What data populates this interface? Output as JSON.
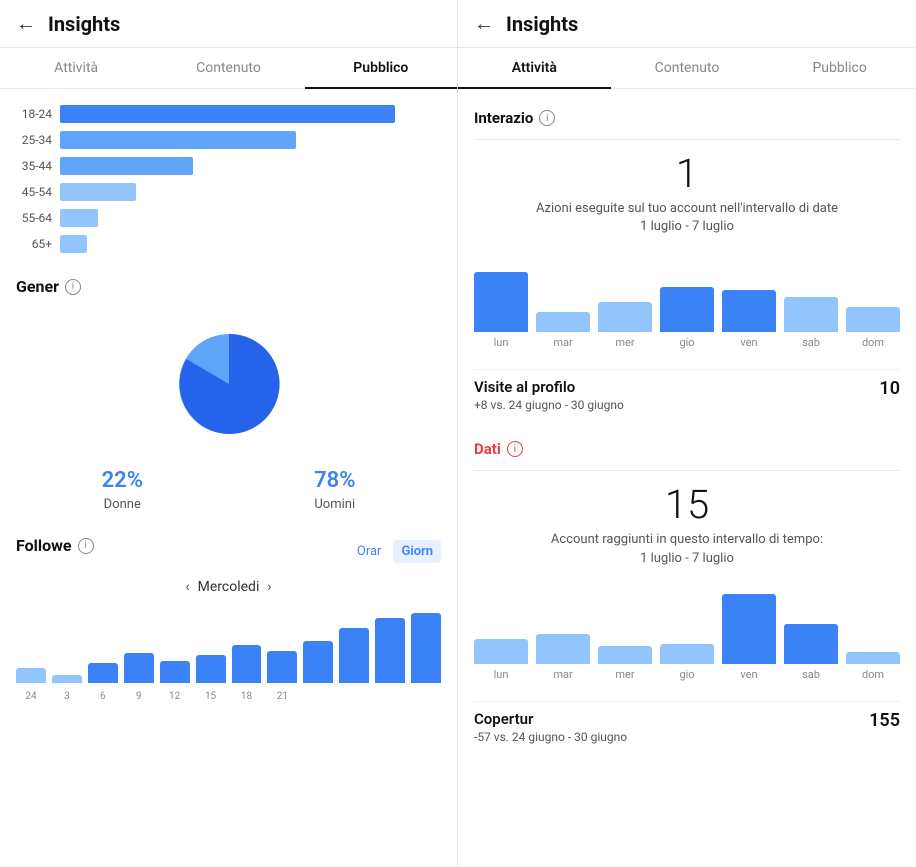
{
  "left": {
    "header": {
      "back_label": "←",
      "title": "Insights"
    },
    "tabs": [
      {
        "label": "Attività",
        "active": false
      },
      {
        "label": "Contenuto",
        "active": false
      },
      {
        "label": "Pubblico",
        "active": true
      }
    ],
    "age_bars": {
      "rows": [
        {
          "label": "18-24",
          "width": 88,
          "shade": "dark"
        },
        {
          "label": "25-34",
          "width": 62,
          "shade": "medium"
        },
        {
          "label": "35-44",
          "width": 35,
          "shade": "medium"
        },
        {
          "label": "45-54",
          "width": 20,
          "shade": "light"
        },
        {
          "label": "55-64",
          "width": 10,
          "shade": "light"
        },
        {
          "label": "65+",
          "width": 7,
          "shade": "light"
        }
      ]
    },
    "gender": {
      "title": "Gener",
      "female_pct": "22%",
      "female_label": "Donne",
      "male_pct": "78%",
      "male_label": "Uomini"
    },
    "followers": {
      "title": "Followe",
      "nav_label": "Mercoledi",
      "toggle_hour": "Orar",
      "toggle_day": "Giorn",
      "bars": [
        {
          "height": 15,
          "light": true
        },
        {
          "height": 8,
          "light": true
        },
        {
          "height": 20,
          "light": false
        },
        {
          "height": 35,
          "light": false
        },
        {
          "height": 22,
          "light": false
        },
        {
          "height": 28,
          "light": false
        },
        {
          "height": 38,
          "light": false
        },
        {
          "height": 32,
          "light": false
        },
        {
          "height": 42,
          "light": false
        },
        {
          "height": 55,
          "light": false
        },
        {
          "height": 65,
          "light": false
        },
        {
          "height": 70,
          "light": false
        }
      ],
      "x_labels": [
        "24",
        "3",
        "6",
        "9",
        "12",
        "15",
        "18",
        "21",
        "",
        "",
        "",
        ""
      ]
    }
  },
  "right": {
    "header": {
      "back_label": "←",
      "title": "Insights"
    },
    "tabs": [
      {
        "label": "Attività",
        "active": true
      },
      {
        "label": "Contenuto",
        "active": false
      },
      {
        "label": "Pubblico",
        "active": false
      }
    ],
    "interazioni": {
      "section_label": "Interazio",
      "big_number": "1",
      "sub_text": "Azioni eseguite sul tuo account nell'intervallo di date",
      "date_range": "1 luglio - 7 luglio",
      "bars": [
        {
          "height": 60,
          "shade": "dark"
        },
        {
          "height": 20,
          "shade": "light"
        },
        {
          "height": 30,
          "shade": "light"
        },
        {
          "height": 45,
          "shade": "dark"
        },
        {
          "height": 42,
          "shade": "dark"
        },
        {
          "height": 35,
          "shade": "light"
        },
        {
          "height": 25,
          "shade": "light"
        }
      ],
      "x_labels": [
        "lun",
        "mar",
        "mer",
        "gio",
        "ven",
        "sab",
        "dom"
      ]
    },
    "visite": {
      "name": "Visite al profilo",
      "value": "10",
      "change": "+8 vs. 24 giugno - 30 giugno"
    },
    "dati": {
      "section_label": "Dati",
      "big_number": "15",
      "sub_text": "Account raggiunti in questo intervallo di tempo:",
      "date_range": "1 luglio - 7 luglio",
      "bars": [
        {
          "height": 25,
          "shade": "light"
        },
        {
          "height": 30,
          "shade": "light"
        },
        {
          "height": 18,
          "shade": "light"
        },
        {
          "height": 20,
          "shade": "light"
        },
        {
          "height": 70,
          "shade": "dark"
        },
        {
          "height": 40,
          "shade": "dark"
        },
        {
          "height": 12,
          "shade": "light"
        }
      ],
      "x_labels": [
        "lun",
        "mar",
        "mer",
        "gio",
        "ven",
        "sab",
        "dom"
      ]
    },
    "copertura": {
      "name": "Copertur",
      "value": "155",
      "change": "-57 vs. 24 giugno - 30 giugno"
    }
  }
}
